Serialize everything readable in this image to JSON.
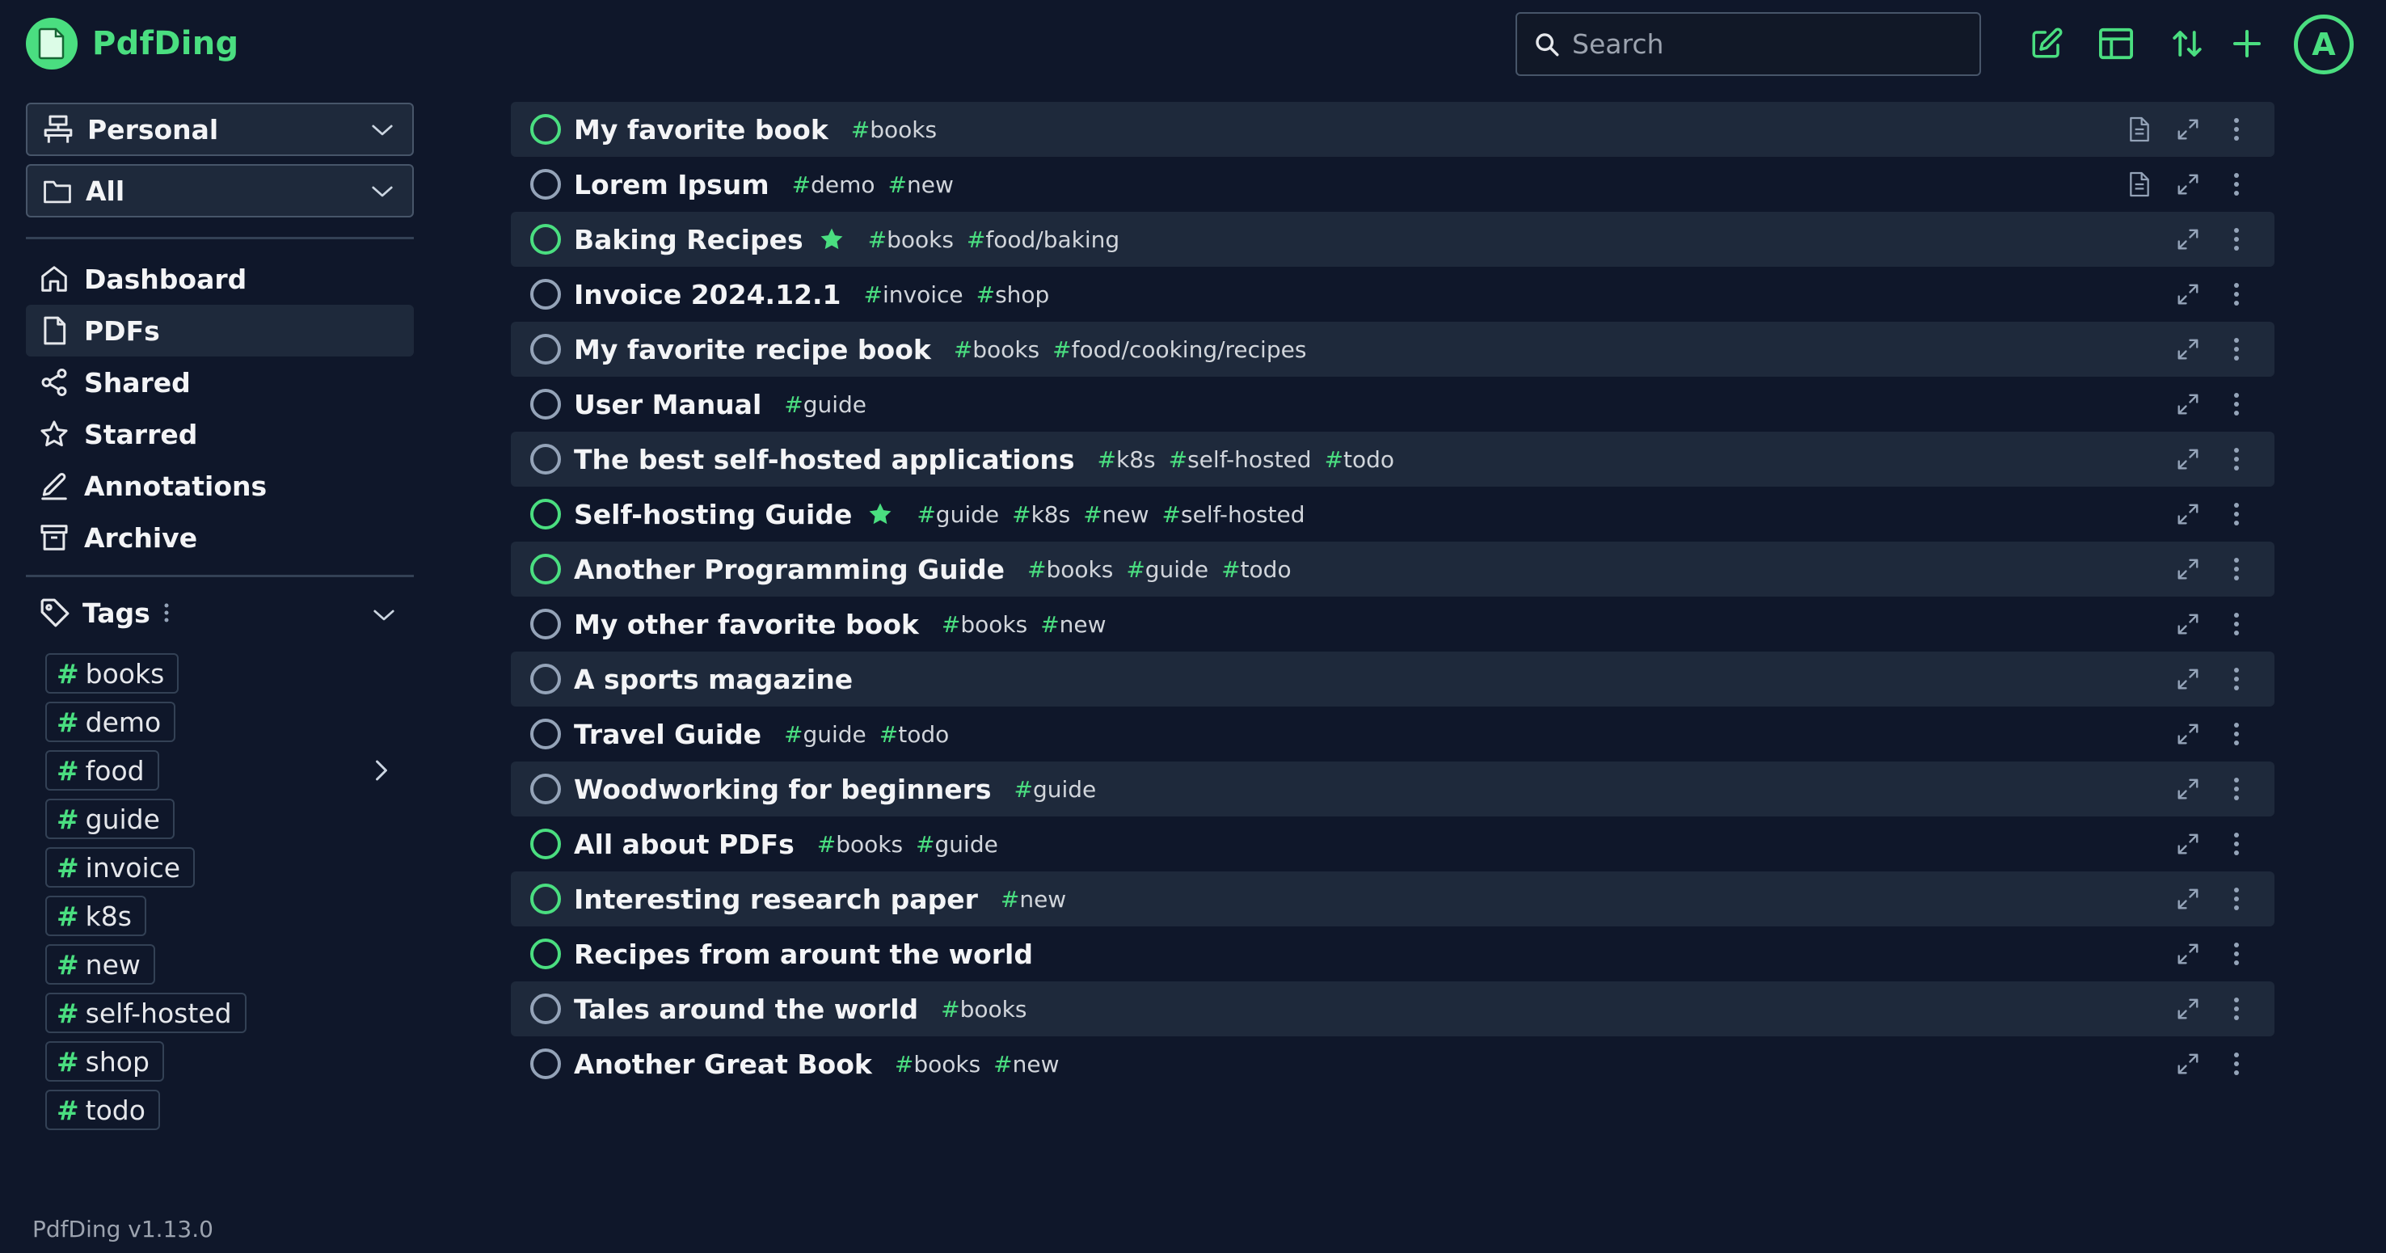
{
  "app": {
    "name": "PdfDing",
    "version": "PdfDing v1.13.0"
  },
  "header": {
    "search_placeholder": "Search",
    "avatar_initial": "A",
    "icons": [
      "edit-icon",
      "layout-icon",
      "sort-icon",
      "plus-icon"
    ]
  },
  "sidebar": {
    "workspace": "Personal",
    "collection": "All",
    "nav": [
      {
        "label": "Dashboard",
        "icon": "home-icon"
      },
      {
        "label": "PDFs",
        "icon": "file-icon",
        "active": true
      },
      {
        "label": "Shared",
        "icon": "share-icon"
      },
      {
        "label": "Starred",
        "icon": "star-icon"
      },
      {
        "label": "Annotations",
        "icon": "pen-icon"
      },
      {
        "label": "Archive",
        "icon": "archive-icon"
      }
    ],
    "tags_label": "Tags",
    "tags": [
      "books",
      "demo",
      "food",
      "guide",
      "invoice",
      "k8s",
      "new",
      "self-hosted",
      "shop",
      "todo"
    ]
  },
  "pdfs": [
    {
      "title": "My favorite book",
      "tags": [
        "books"
      ],
      "starred": false,
      "has_notes": true,
      "ring": "green"
    },
    {
      "title": "Lorem Ipsum",
      "tags": [
        "demo",
        "new"
      ],
      "starred": false,
      "has_notes": true,
      "ring": "grey"
    },
    {
      "title": "Baking Recipes",
      "tags": [
        "books",
        "food/baking"
      ],
      "starred": true,
      "has_notes": false,
      "ring": "green"
    },
    {
      "title": "Invoice 2024.12.1",
      "tags": [
        "invoice",
        "shop"
      ],
      "starred": false,
      "has_notes": false,
      "ring": "grey"
    },
    {
      "title": "My favorite recipe book",
      "tags": [
        "books",
        "food/cooking/recipes"
      ],
      "starred": false,
      "has_notes": false,
      "ring": "grey"
    },
    {
      "title": "User Manual",
      "tags": [
        "guide"
      ],
      "starred": false,
      "has_notes": false,
      "ring": "grey"
    },
    {
      "title": "The best self-hosted applications",
      "tags": [
        "k8s",
        "self-hosted",
        "todo"
      ],
      "starred": false,
      "has_notes": false,
      "ring": "grey"
    },
    {
      "title": "Self-hosting Guide",
      "tags": [
        "guide",
        "k8s",
        "new",
        "self-hosted"
      ],
      "starred": true,
      "has_notes": false,
      "ring": "green"
    },
    {
      "title": "Another Programming Guide",
      "tags": [
        "books",
        "guide",
        "todo"
      ],
      "starred": false,
      "has_notes": false,
      "ring": "green"
    },
    {
      "title": "My other favorite book",
      "tags": [
        "books",
        "new"
      ],
      "starred": false,
      "has_notes": false,
      "ring": "grey"
    },
    {
      "title": "A sports magazine",
      "tags": [],
      "starred": false,
      "has_notes": false,
      "ring": "grey"
    },
    {
      "title": "Travel Guide",
      "tags": [
        "guide",
        "todo"
      ],
      "starred": false,
      "has_notes": false,
      "ring": "grey"
    },
    {
      "title": "Woodworking for beginners",
      "tags": [
        "guide"
      ],
      "starred": false,
      "has_notes": false,
      "ring": "grey"
    },
    {
      "title": "All about PDFs",
      "tags": [
        "books",
        "guide"
      ],
      "starred": false,
      "has_notes": false,
      "ring": "green"
    },
    {
      "title": "Interesting research paper",
      "tags": [
        "new"
      ],
      "starred": false,
      "has_notes": false,
      "ring": "green"
    },
    {
      "title": "Recipes from arount the world",
      "tags": [],
      "starred": false,
      "has_notes": false,
      "ring": "green"
    },
    {
      "title": "Tales around the world",
      "tags": [
        "books"
      ],
      "starred": false,
      "has_notes": false,
      "ring": "grey"
    },
    {
      "title": "Another Great Book",
      "tags": [
        "books",
        "new"
      ],
      "starred": false,
      "has_notes": false,
      "ring": "grey"
    }
  ],
  "colors": {
    "accent": "#4ade80",
    "background": "#0f172a",
    "row_alt": "#1e293b",
    "muted": "#94a3b8"
  }
}
